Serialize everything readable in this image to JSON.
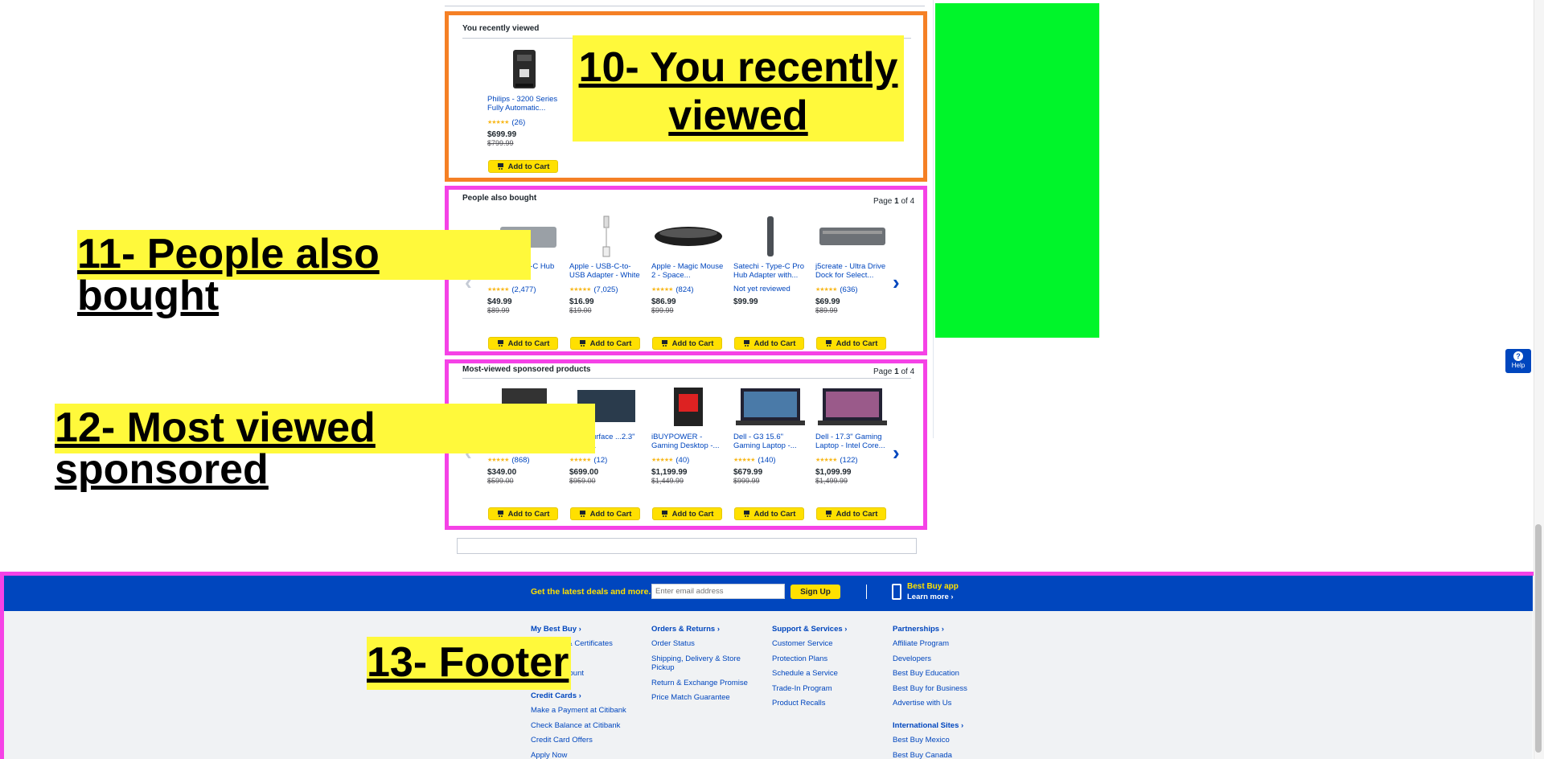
{
  "recently_viewed": {
    "title": "You recently viewed",
    "product": {
      "name": "Philips - 3200 Series Fully Automatic...",
      "rating_count": "(26)",
      "price": "$699.99",
      "was": "$799.99",
      "cart_label": "Add to Cart",
      "icon": "espresso-machine-icon"
    }
  },
  "people_also_bought": {
    "title": "People also bought",
    "page_prefix": "Page ",
    "page_current": "1",
    "page_of": " of ",
    "page_total": "4",
    "products": [
      {
        "name": "... USB Type-C Hub for...",
        "rating_count": "(2,477)",
        "reviewed": true,
        "price": "$49.99",
        "was": "$89.99",
        "cart_label": "Add to Cart"
      },
      {
        "name": "Apple - USB-C-to-USB Adapter - White",
        "rating_count": "(7,025)",
        "reviewed": true,
        "price": "$16.99",
        "was": "$19.00",
        "cart_label": "Add to Cart"
      },
      {
        "name": "Apple - Magic Mouse 2 - Space...",
        "rating_count": "(824)",
        "reviewed": true,
        "price": "$86.99",
        "was": "$99.99",
        "cart_label": "Add to Cart"
      },
      {
        "name": "Satechi - Type-C Pro Hub Adapter with...",
        "rating_count": "",
        "not_reviewed": "Not yet reviewed",
        "reviewed": false,
        "price": "$99.99",
        "was": "",
        "cart_label": "Add to Cart"
      },
      {
        "name": "j5create - Ultra Drive Dock for Select...",
        "rating_count": "(636)",
        "reviewed": true,
        "price": "$69.99",
        "was": "$89.99",
        "cart_label": "Add to Cart"
      }
    ]
  },
  "sponsored": {
    "title": "Most-viewed sponsored products",
    "page_prefix": "Page ",
    "page_current": "1",
    "page_of": " of ",
    "page_total": "4",
    "products": [
      {
        "name": "",
        "rating_count": "(868)",
        "price": "$349.00",
        "was": "$599.00",
        "cart_label": "Add to Cart"
      },
      {
        "name": "...ft - Surface ...2.3\" Touch...",
        "rating_count": "(12)",
        "price": "$699.00",
        "was": "$959.00",
        "cart_label": "Add to Cart"
      },
      {
        "name": "iBUYPOWER - Gaming Desktop -...",
        "rating_count": "(40)",
        "price": "$1,199.99",
        "was": "$1,449.99",
        "cart_label": "Add to Cart"
      },
      {
        "name": "Dell - G3 15.6\" Gaming Laptop -...",
        "rating_count": "(140)",
        "price": "$679.99",
        "was": "$999.99",
        "cart_label": "Add to Cart"
      },
      {
        "name": "Dell - 17.3\" Gaming Laptop - Intel Core...",
        "rating_count": "(122)",
        "price": "$1,099.99",
        "was": "$1,499.99",
        "cart_label": "Add to Cart"
      }
    ]
  },
  "callouts": {
    "c10": "10- You recently viewed",
    "c11": "11- People also bought",
    "c12": "12- Most viewed sponsored",
    "c13": "13- Footer"
  },
  "footer": {
    "deals_label": "Get the latest deals and more.",
    "email_placeholder": "Enter email address",
    "signup_label": "Sign Up",
    "app_title": "Best Buy app",
    "app_learn": "Learn more ›",
    "columns": [
      {
        "heading": "My Best Buy ›",
        "links": [
          "Gift Cards & Certificates",
          "...ers",
          "...reate Account"
        ]
      },
      {
        "heading": "Orders & Returns ›",
        "links": [
          "Order Status",
          "Shipping, Delivery & Store Pickup",
          "Return & Exchange Promise",
          "Price Match Guarantee"
        ]
      },
      {
        "heading": "Support & Services ›",
        "links": [
          "Customer Service",
          "Protection Plans",
          "Schedule a Service",
          "Trade-In Program",
          "Product Recalls"
        ]
      },
      {
        "heading": "Partnerships ›",
        "links": [
          "Affiliate Program",
          "Developers",
          "Best Buy Education",
          "Best Buy for Business",
          "Advertise with Us"
        ]
      }
    ],
    "credit_heading": "Credit Cards ›",
    "credit_links": [
      "Make a Payment at Citibank",
      "Check Balance at Citibank",
      "Credit Card Offers",
      "Apply Now"
    ],
    "intl_heading": "International Sites ›",
    "intl_links": [
      "Best Buy Mexico",
      "Best Buy Canada"
    ]
  },
  "help_label": "Help",
  "colors": {
    "brand_blue": "#0046be",
    "brand_yellow": "#ffe000",
    "callout_yellow": "#fff93b",
    "ad_green": "#00f52a",
    "orange_border": "#f58025",
    "pink_border": "#f542e6"
  }
}
